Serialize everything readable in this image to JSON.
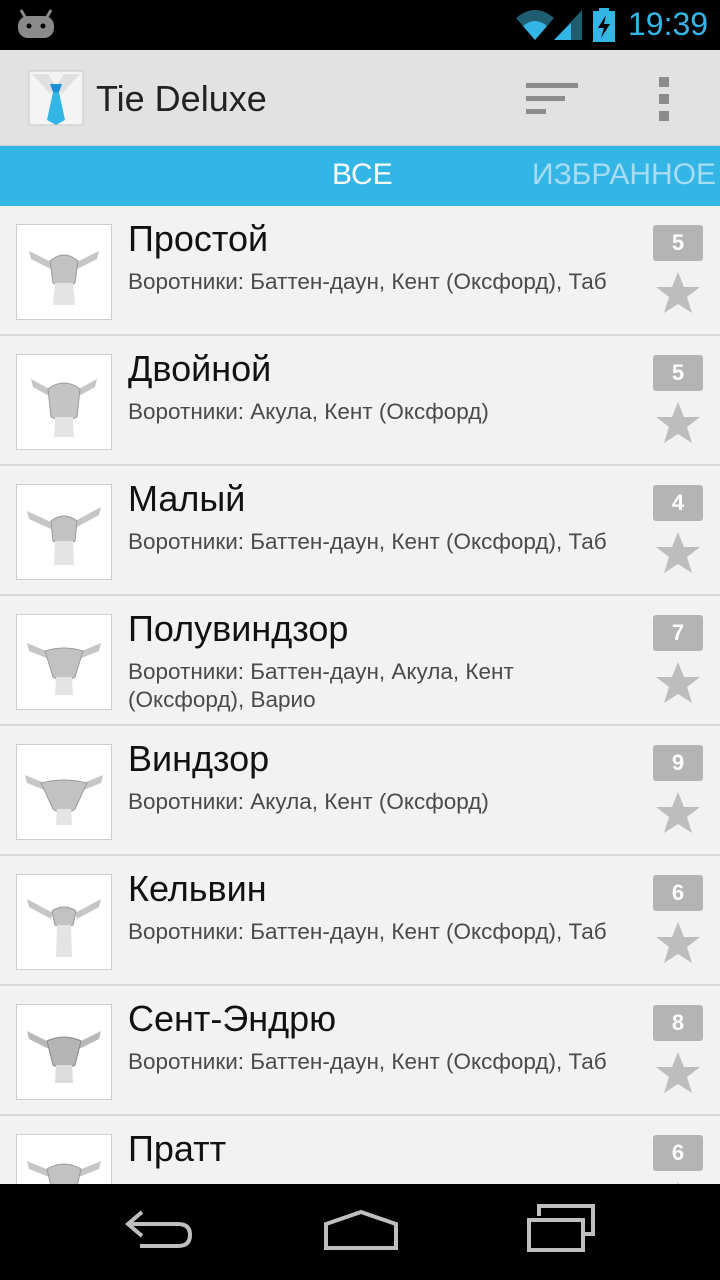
{
  "status_bar": {
    "time": "19:39"
  },
  "app_bar": {
    "title": "Tie Deluxe"
  },
  "tabs": [
    {
      "label": "ВСЕ",
      "selected": true
    },
    {
      "label": "ИЗБРАННОЕ",
      "selected": false
    }
  ],
  "knots": [
    {
      "name": "Простой",
      "collars": "Воротники: Баттен-даун, Кент (Оксфорд), Таб",
      "difficulty": "5"
    },
    {
      "name": "Двойной",
      "collars": "Воротники: Акула, Кент (Оксфорд)",
      "difficulty": "5"
    },
    {
      "name": "Малый",
      "collars": "Воротники: Баттен-даун, Кент (Оксфорд), Таб",
      "difficulty": "4"
    },
    {
      "name": "Полувиндзор",
      "collars": "Воротники: Баттен-даун, Акула, Кент (Оксфорд), Варио",
      "difficulty": "7"
    },
    {
      "name": "Виндзор",
      "collars": "Воротники: Акула, Кент (Оксфорд)",
      "difficulty": "9"
    },
    {
      "name": "Кельвин",
      "collars": "Воротники: Баттен-даун, Кент (Оксфорд), Таб",
      "difficulty": "6"
    },
    {
      "name": "Сент-Эндрю",
      "collars": "Воротники: Баттен-даун, Кент (Оксфорд), Таб",
      "difficulty": "8"
    },
    {
      "name": "Пратт",
      "collars": "",
      "difficulty": "6"
    }
  ],
  "icons": {
    "status": [
      "android-icon",
      "wifi-icon",
      "signal-icon",
      "battery-charging-icon"
    ],
    "app_bar": [
      "app-tie-icon",
      "sort-icon",
      "overflow-menu-icon"
    ],
    "row": [
      "knot-thumbnail",
      "favorite-star-icon"
    ],
    "nav": [
      "back-icon",
      "home-icon",
      "recents-icon"
    ]
  },
  "colors": {
    "accent": "#33b5e5",
    "tab_inactive": "#a8dcf3",
    "badge": "#b4b4b4",
    "star": "#bdbdbd",
    "list_bg": "#f2f2f2",
    "app_bar_bg": "#e2e2e2"
  }
}
